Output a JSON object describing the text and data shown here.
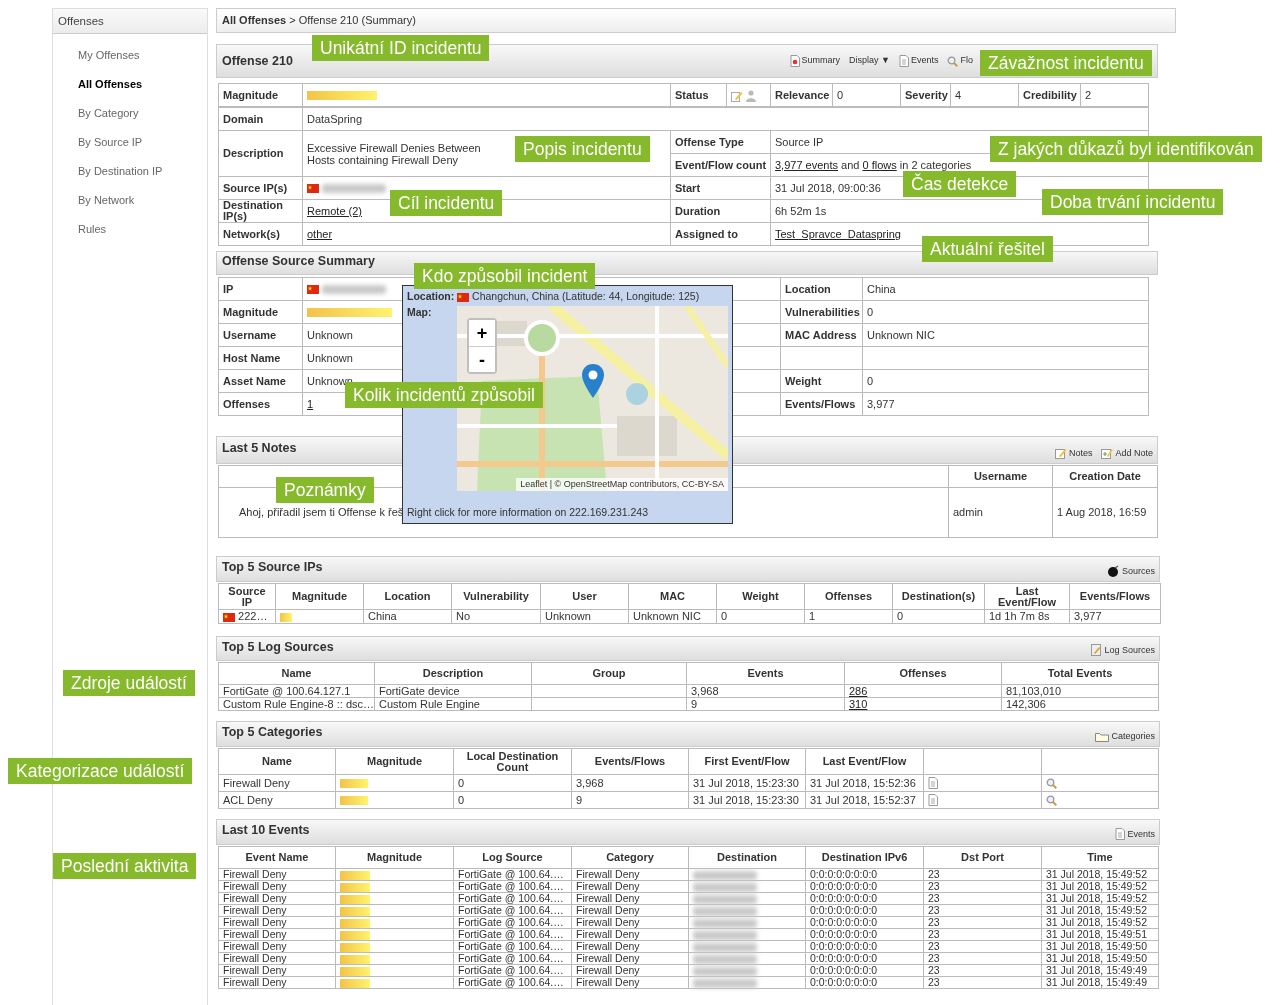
{
  "sidebar": {
    "title": "Offenses",
    "items": [
      {
        "label": "My Offenses",
        "selected": false
      },
      {
        "label": "All Offenses",
        "selected": true
      },
      {
        "label": "By Category",
        "selected": false
      },
      {
        "label": "By Source IP",
        "selected": false
      },
      {
        "label": "By Destination IP",
        "selected": false
      },
      {
        "label": "By Network",
        "selected": false
      },
      {
        "label": "Rules",
        "selected": false
      }
    ]
  },
  "breadcrumb": {
    "parent": "All Offenses",
    "current": "> Offense 210 (Summary)"
  },
  "offense": {
    "title": "Offense 210",
    "tools": [
      {
        "label": "Summary",
        "kind": "summary"
      },
      {
        "label": "Display ▼",
        "kind": "menu"
      },
      {
        "label": "Events",
        "kind": "doc"
      },
      {
        "label": "Flo",
        "kind": "search"
      }
    ],
    "top_row": [
      {
        "label": "Magnitude",
        "value": {
          "kind": "bar"
        }
      },
      {
        "label": "Status",
        "value": {
          "kind": "status"
        }
      },
      {
        "label": "Relevance",
        "value": "0"
      },
      {
        "label": "Severity",
        "value": "4"
      },
      {
        "label": "Credibility",
        "value": "2"
      }
    ],
    "domain": {
      "label": "Domain",
      "value": "DataSpring"
    },
    "description": {
      "label": "Description",
      "value": "Excessive Firewall Denies Between Hosts containing Firewall Deny"
    },
    "offense_type": {
      "label": "Offense Type",
      "value": "Source IP"
    },
    "event_flow_count": {
      "label": "Event/Flow count",
      "value": {
        "kind": "sentence",
        "parts": [
          {
            "link": "3,977 events"
          },
          {
            "text": " and "
          },
          {
            "link": "0 flows"
          },
          {
            "text": " in 2 categories"
          }
        ]
      }
    },
    "pairs": [
      [
        {
          "label": "Source IP(s)",
          "value": {
            "kind": "ip"
          }
        },
        {
          "label": "Start",
          "value": "31 Jul 2018, 09:00:36"
        }
      ],
      [
        {
          "label": "Destination IP(s)",
          "value": {
            "kind": "link",
            "text": "Remote (2)"
          }
        },
        {
          "label": "Duration",
          "value": "6h 52m 1s"
        }
      ],
      [
        {
          "label": "Network(s)",
          "value": {
            "kind": "link",
            "text": "other"
          }
        },
        {
          "label": "Assigned to",
          "value": {
            "kind": "link",
            "text": "Test_Spravce_Dataspring"
          }
        }
      ]
    ]
  },
  "source_summary": {
    "title": "Offense Source Summary",
    "rows": [
      [
        {
          "label": "IP",
          "value": {
            "kind": "ip"
          }
        },
        {
          "label": "Location",
          "value": "China"
        }
      ],
      [
        {
          "label": "Magnitude",
          "value": {
            "kind": "bar"
          }
        },
        {
          "label": "Vulnerabilities",
          "value": "0"
        }
      ],
      [
        {
          "label": "Username",
          "value": "Unknown"
        },
        {
          "label": "MAC Address",
          "value": "Unknown NIC"
        }
      ],
      [
        {
          "label": "Host Name",
          "value": "Unknown"
        },
        null
      ],
      [
        {
          "label": "Asset Name",
          "value": "Unknown"
        },
        {
          "label": "Weight",
          "value": "0"
        }
      ],
      [
        {
          "label": "Offenses",
          "value": {
            "kind": "link",
            "text": "1"
          }
        },
        {
          "label": "Events/Flows",
          "value": "3,977"
        }
      ]
    ]
  },
  "map_popup": {
    "location_label": "Location:",
    "location": "Changchun, China (Latitude: 44, Longitude: 125)",
    "map_label": "Map:",
    "zoom_in": "+",
    "zoom_out": "-",
    "attribution": [
      {
        "link": "Leaflet"
      },
      {
        "text": " | © "
      },
      {
        "link": "OpenStreetMap"
      },
      {
        "text": " contributors, "
      },
      {
        "link": "CC-BY-SA"
      }
    ],
    "footer": "Right click for more information on 222.169.231.243"
  },
  "notes": {
    "title": "Last 5 Notes",
    "tools": [
      {
        "label": "Notes",
        "kind": "note"
      },
      {
        "label": "Add Note",
        "kind": "add-note"
      }
    ],
    "columns": [
      null,
      "Username",
      "Creation Date"
    ],
    "rows": [
      [
        "Ahoj, přiřadil jsem ti Offense k řeš",
        "admin",
        "1 Aug 2018, 16:59"
      ]
    ]
  },
  "sections": [
    {
      "title": "Top 5 Source IPs",
      "tools": [
        {
          "label": "Sources",
          "kind": "sources"
        }
      ],
      "columns": [
        "Source IP",
        "Magnitude",
        "Location",
        "Vulnerability",
        "User",
        "MAC",
        "Weight",
        "Offenses",
        "Destination(s)",
        "Last Event/Flow",
        "Events/Flows"
      ],
      "rows": [
        [
          {
            "kind": "ip",
            "text": "222…"
          },
          {
            "kind": "bar"
          },
          "China",
          "No",
          "Unknown",
          "Unknown NIC",
          "0",
          "1",
          "0",
          "1d 1h 7m 8s",
          "3,977"
        ]
      ]
    },
    {
      "title": "Top 5 Log Sources",
      "tools": [
        {
          "label": "Log Sources",
          "kind": "log-sources"
        }
      ],
      "columns": [
        "Name",
        "Description",
        "Group",
        "Events",
        "Offenses",
        "Total Events"
      ],
      "rows": [
        [
          "FortiGate @ 100.64.127.1",
          "FortiGate device",
          null,
          "3,968",
          {
            "kind": "link",
            "text": "286"
          },
          "81,103,010"
        ],
        [
          "Custom Rule Engine-8 :: dsc…",
          "Custom Rule Engine",
          null,
          "9",
          {
            "kind": "link",
            "text": "310"
          },
          "142,306"
        ]
      ]
    },
    {
      "title": "Top 5 Categories",
      "tools": [
        {
          "label": "Categories",
          "kind": "folder"
        }
      ],
      "columns": [
        "Name",
        "Magnitude",
        "Local Destination Count",
        "Events/Flows",
        "First Event/Flow",
        "Last Event/Flow",
        null,
        null
      ],
      "rows": [
        [
          "Firewall Deny",
          {
            "kind": "bar"
          },
          "0",
          "3,968",
          "31 Jul 2018, 15:23:30",
          "31 Jul 2018, 15:52:36",
          {
            "kind": "doc"
          },
          {
            "kind": "lens"
          }
        ],
        [
          "ACL Deny",
          {
            "kind": "bar"
          },
          "0",
          "9",
          "31 Jul 2018, 15:23:30",
          "31 Jul 2018, 15:52:37",
          {
            "kind": "doc"
          },
          {
            "kind": "lens"
          }
        ]
      ]
    },
    {
      "title": "Last 10 Events",
      "tools": [
        {
          "label": "Events",
          "kind": "doc"
        }
      ],
      "columns": [
        "Event Name",
        "Magnitude",
        "Log Source",
        "Category",
        "Destination",
        "Destination IPv6",
        "Dst Port",
        "Time"
      ],
      "rows": [
        [
          "Firewall Deny",
          {
            "kind": "bar"
          },
          "FortiGate @ 100.64.…",
          "Firewall Deny",
          {
            "kind": "redacted"
          },
          "0:0:0:0:0:0:0:0",
          "23",
          "31 Jul 2018, 15:49:52"
        ],
        [
          "Firewall Deny",
          {
            "kind": "bar"
          },
          "FortiGate @ 100.64.…",
          "Firewall Deny",
          {
            "kind": "redacted"
          },
          "0:0:0:0:0:0:0:0",
          "23",
          "31 Jul 2018, 15:49:52"
        ],
        [
          "Firewall Deny",
          {
            "kind": "bar"
          },
          "FortiGate @ 100.64.…",
          "Firewall Deny",
          {
            "kind": "redacted"
          },
          "0:0:0:0:0:0:0:0",
          "23",
          "31 Jul 2018, 15:49:52"
        ],
        [
          "Firewall Deny",
          {
            "kind": "bar"
          },
          "FortiGate @ 100.64.…",
          "Firewall Deny",
          {
            "kind": "redacted"
          },
          "0:0:0:0:0:0:0:0",
          "23",
          "31 Jul 2018, 15:49:52"
        ],
        [
          "Firewall Deny",
          {
            "kind": "bar"
          },
          "FortiGate @ 100.64.…",
          "Firewall Deny",
          {
            "kind": "redacted"
          },
          "0:0:0:0:0:0:0:0",
          "23",
          "31 Jul 2018, 15:49:52"
        ],
        [
          "Firewall Deny",
          {
            "kind": "bar"
          },
          "FortiGate @ 100.64.…",
          "Firewall Deny",
          {
            "kind": "redacted"
          },
          "0:0:0:0:0:0:0:0",
          "23",
          "31 Jul 2018, 15:49:51"
        ],
        [
          "Firewall Deny",
          {
            "kind": "bar"
          },
          "FortiGate @ 100.64.…",
          "Firewall Deny",
          {
            "kind": "redacted"
          },
          "0:0:0:0:0:0:0:0",
          "23",
          "31 Jul 2018, 15:49:50"
        ],
        [
          "Firewall Deny",
          {
            "kind": "bar"
          },
          "FortiGate @ 100.64.…",
          "Firewall Deny",
          {
            "kind": "redacted"
          },
          "0:0:0:0:0:0:0:0",
          "23",
          "31 Jul 2018, 15:49:50"
        ],
        [
          "Firewall Deny",
          {
            "kind": "bar"
          },
          "FortiGate @ 100.64.…",
          "Firewall Deny",
          {
            "kind": "redacted"
          },
          "0:0:0:0:0:0:0:0",
          "23",
          "31 Jul 2018, 15:49:49"
        ],
        [
          "Firewall Deny",
          {
            "kind": "bar"
          },
          "FortiGate @ 100.64.…",
          "Firewall Deny",
          {
            "kind": "redacted"
          },
          "0:0:0:0:0:0:0:0",
          "23",
          "31 Jul 2018, 15:49:49"
        ]
      ]
    }
  ],
  "callouts": [
    "Unikátní ID incidentu",
    "Závažnost incidentu",
    "Popis incidentu",
    "Z jakých důkazů byl identifikován",
    "Čas detekce",
    "Cíl incidentu",
    "Doba trvání incidentu",
    "Aktuální řešitel",
    "Kdo způsobil incident",
    "Kolik incidentů způsobil",
    "Poznámky",
    "Zdroje událostí",
    "Kategorizace událostí",
    "Poslední aktivita"
  ]
}
